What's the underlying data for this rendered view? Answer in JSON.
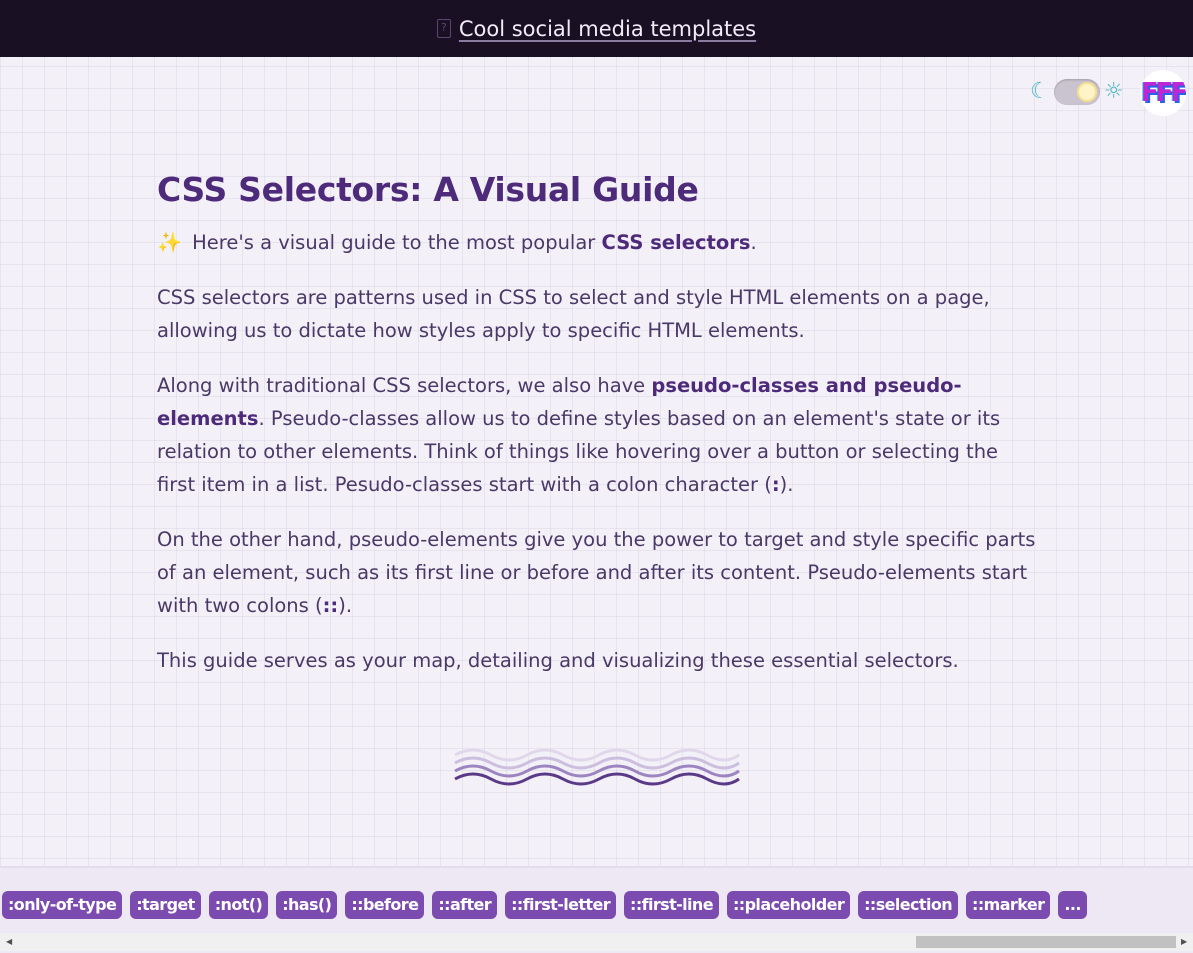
{
  "banner": {
    "icon": "document-icon",
    "link_text": "Cool social media templates"
  },
  "theme_toggle": {
    "moon_icon": "☾",
    "sun_icon": "☼",
    "mode": "light"
  },
  "avatar": {
    "text": "FFF"
  },
  "article": {
    "title": "CSS Selectors: A Visual Guide",
    "intro_emoji": "✨",
    "intro_prefix": " Here's a visual guide to the most popular ",
    "intro_bold": "CSS selectors",
    "intro_suffix": ".",
    "p1": "CSS selectors are patterns used in CSS to select and style HTML elements on a page, allowing us to dictate how styles apply to specific HTML elements.",
    "p2_prefix": "Along with traditional CSS selectors, we also have ",
    "p2_bold": "pseudo-classes and pseudo-elements",
    "p2_suffix": ". Pseudo-classes allow us to define styles based on an element's state or its relation to other elements. Think of things like hovering over a button or selecting the first item in a list. Pesudo-classes start with a colon character (",
    "p2_code": ":",
    "p2_end": ").",
    "p3_prefix": "On the other hand, pseudo-elements give you the power to target and style specific parts of an element, such as its first line or before and after its content. Pseudo-elements start with two colons (",
    "p3_code": "::",
    "p3_end": ").",
    "p4": "This guide serves as your map, detailing and visualizing these essential selectors."
  },
  "selectors": [
    ":only-of-type",
    ":target",
    ":not()",
    ":has()",
    "::before",
    "::after",
    "::first-letter",
    "::first-line",
    "::placeholder",
    "::selection",
    "::marker",
    "..."
  ],
  "colors": {
    "banner_bg": "#1a1024",
    "title": "#4d2a7a",
    "chip_bg": "#7b4bb0",
    "toggle_icon": "#4fb7c4"
  }
}
